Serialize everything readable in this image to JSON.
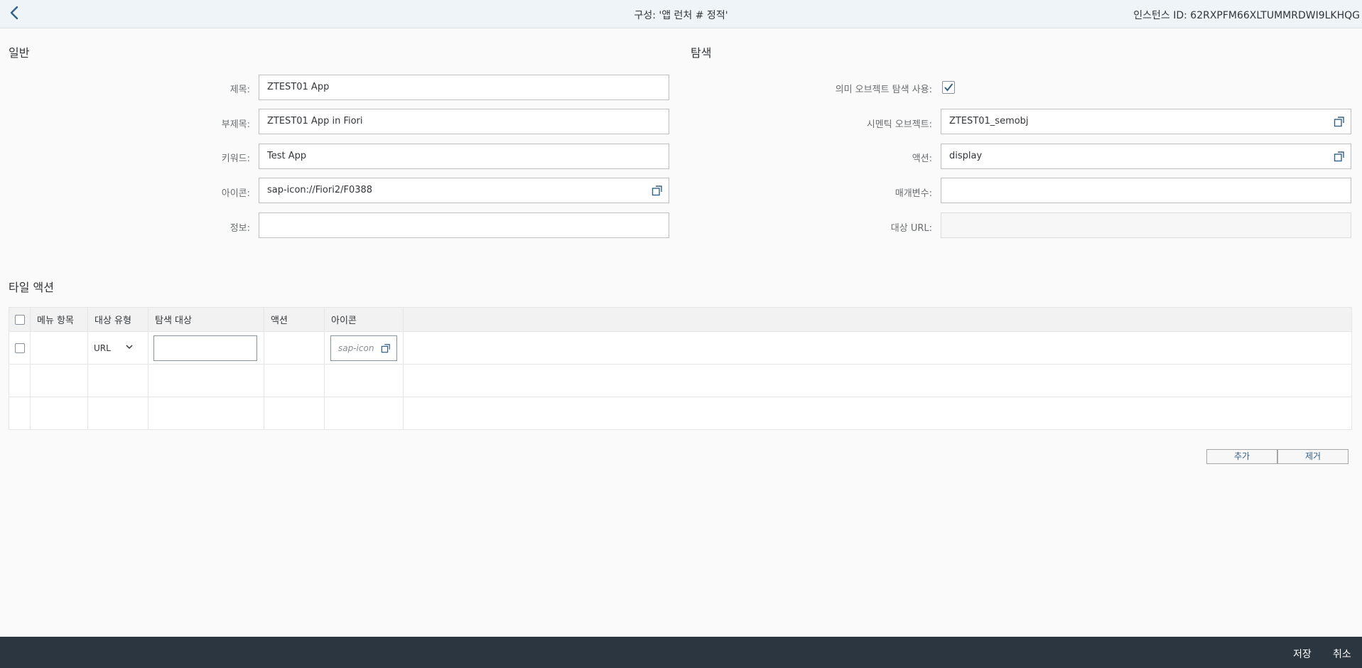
{
  "header": {
    "back_icon": "chevron-left-icon",
    "title": "구성: '앱 런처 # 정적'",
    "instance_id": "인스턴스 ID: 62RXPFM66XLTUMMRDWI9LKHQG"
  },
  "general": {
    "section_title": "일반",
    "fields": {
      "title": {
        "label": "제목:",
        "value": "ZTEST01 App"
      },
      "subtitle": {
        "label": "부제목:",
        "value": "ZTEST01 App in Fiori"
      },
      "keywords": {
        "label": "키워드:",
        "value": "Test App"
      },
      "icon": {
        "label": "아이콘:",
        "value": "sap-icon://Fiori2/F0388"
      },
      "info": {
        "label": "정보:",
        "value": ""
      }
    }
  },
  "navigation": {
    "section_title": "탐색",
    "use_semantic_label": "의미 오브젝트 탐색 사용:",
    "use_semantic_checked": true,
    "fields": {
      "semantic_object": {
        "label": "시멘틱 오브젝트:",
        "value": "ZTEST01_semobj"
      },
      "action": {
        "label": "액션:",
        "value": "display"
      },
      "parameters": {
        "label": "매개변수:",
        "value": ""
      },
      "target_url": {
        "label": "대상 URL:",
        "value": ""
      }
    }
  },
  "tile_actions": {
    "section_title": "타일 액션",
    "columns": {
      "menu_item": "메뉴 항목",
      "target_type": "대상 유형",
      "nav_target": "탐색 대상",
      "action": "액션",
      "icon": "아이콘"
    },
    "row": {
      "target_type_value": "URL",
      "icon_placeholder": "sap-icon"
    },
    "add_label": "추가",
    "remove_label": "제거"
  },
  "footer": {
    "save_label": "저장",
    "cancel_label": "취소"
  },
  "colors": {
    "accent": "#346187",
    "footer_bg": "#2c3641",
    "topbar_bg": "#eff4f9"
  }
}
